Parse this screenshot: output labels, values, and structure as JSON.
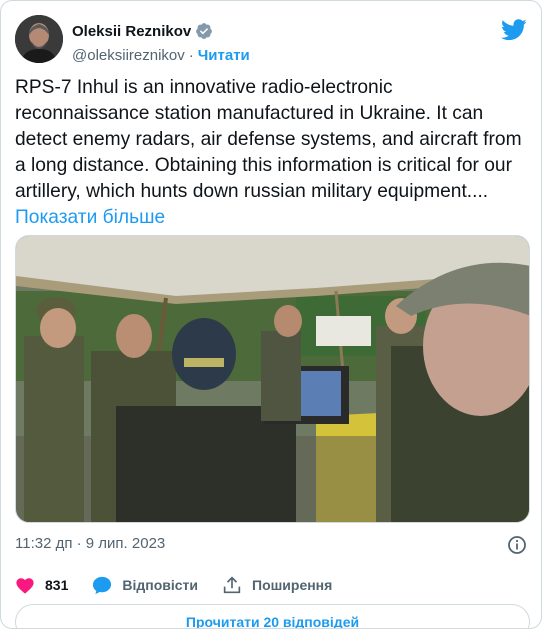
{
  "author": {
    "name": "Oleksii Reznikov",
    "handle": "@oleksiireznikov",
    "separator": "·",
    "follow_label": "Читати"
  },
  "tweet": {
    "text": "RPS-7 Inhul is an innovative radio-electronic reconnaissance station manufactured in Ukraine. It can detect enemy radars, air defense systems, and aircraft from a long distance. Obtaining this information is critical for our artillery, which hunts down russian military equipment....",
    "show_more": "Показати більше",
    "timestamp": "11:32 дп · 9 лип. 2023"
  },
  "actions": {
    "likes": "831",
    "reply_label": "Відповісти",
    "share_label": "Поширення"
  },
  "read_replies_label": "Прочитати 20 відповідей",
  "icons": {
    "verified": "verified-badge-icon",
    "bird": "twitter-bird-icon",
    "info": "info-icon",
    "like": "heart-icon",
    "reply": "reply-bubble-icon",
    "share": "share-icon"
  },
  "colors": {
    "accent": "#1d9bf0",
    "like": "#f91880",
    "muted": "#536471",
    "text": "#0f1419"
  }
}
